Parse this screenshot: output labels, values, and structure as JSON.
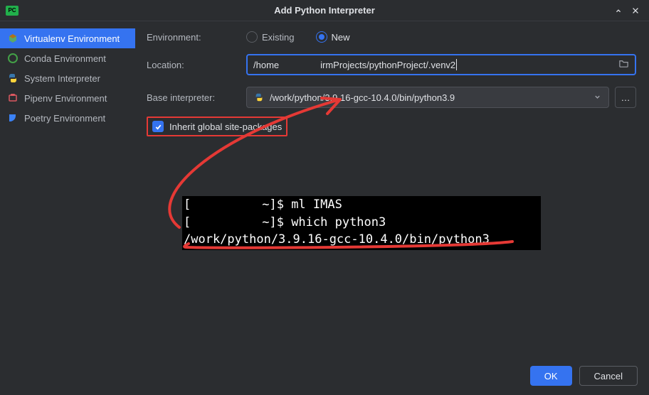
{
  "titlebar": {
    "app_icon_text": "PC",
    "title": "Add Python Interpreter"
  },
  "sidebar": {
    "items": [
      {
        "label": "Virtualenv Environment",
        "selected": true,
        "icon_name": "virtualenv-icon"
      },
      {
        "label": "Conda Environment",
        "selected": false,
        "icon_name": "conda-icon"
      },
      {
        "label": "System Interpreter",
        "selected": false,
        "icon_name": "python-icon"
      },
      {
        "label": "Pipenv Environment",
        "selected": false,
        "icon_name": "pipenv-icon"
      },
      {
        "label": "Poetry Environment",
        "selected": false,
        "icon_name": "poetry-icon"
      }
    ]
  },
  "form": {
    "environment_label": "Environment:",
    "radio_existing": "Existing",
    "radio_new": "New",
    "location_label": "Location:",
    "location_left": "/home",
    "location_right": "irmProjects/pythonProject/.venv2",
    "base_interpreter_label": "Base interpreter:",
    "base_interpreter_value": "/work/python/3.9.16-gcc-10.4.0/bin/python3.9",
    "inherit_label": "Inherit global site-packages",
    "ellipsis": "…"
  },
  "terminal": {
    "line1_left": "[",
    "line1_right": "~]$ ml IMAS",
    "line2_left": "[",
    "line2_right": "~]$ which python3",
    "line3": "/work/python/3.9.16-gcc-10.4.0/bin/python3"
  },
  "footer": {
    "ok": "OK",
    "cancel": "Cancel"
  },
  "annotation_color": "#e53935"
}
